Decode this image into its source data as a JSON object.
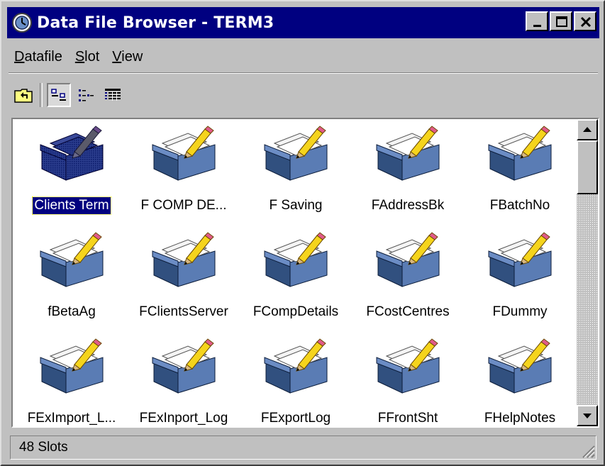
{
  "window": {
    "title": "Data File Browser - TERM3",
    "app_icon": "clock-globe-icon",
    "controls": [
      "minimize-icon",
      "maximize-icon",
      "close-icon"
    ]
  },
  "menu": {
    "items": [
      {
        "label": "Datafile",
        "mnemonic": "D"
      },
      {
        "label": "Slot",
        "mnemonic": "S"
      },
      {
        "label": "View",
        "mnemonic": "V"
      }
    ]
  },
  "toolbar": {
    "buttons": [
      {
        "icon": "up-folder-icon",
        "pressed": false
      },
      {
        "icon": "large-icons-view-icon",
        "pressed": true
      },
      {
        "icon": "small-icons-view-icon",
        "pressed": false
      },
      {
        "icon": "details-view-icon",
        "pressed": false
      }
    ]
  },
  "files": {
    "items": [
      {
        "label": "Clients Term",
        "selected": true
      },
      {
        "label": "F COMP DE...",
        "selected": false
      },
      {
        "label": "F Saving",
        "selected": false
      },
      {
        "label": "FAddressBk",
        "selected": false
      },
      {
        "label": "FBatchNo",
        "selected": false
      },
      {
        "label": "fBetaAg",
        "selected": false
      },
      {
        "label": "FClientsServer",
        "selected": false
      },
      {
        "label": "FCompDetails",
        "selected": false
      },
      {
        "label": "FCostCentres",
        "selected": false
      },
      {
        "label": "FDummy",
        "selected": false
      },
      {
        "label": "FExImport_L...",
        "selected": false
      },
      {
        "label": "FExInport_Log",
        "selected": false
      },
      {
        "label": "FExportLog",
        "selected": false
      },
      {
        "label": "FFrontSht",
        "selected": false
      },
      {
        "label": "FHelpNotes",
        "selected": false
      }
    ],
    "item_icon": "folder-pencil-icon"
  },
  "status": {
    "text": "48 Slots"
  },
  "colors": {
    "titlebar": "#000080",
    "face": "#c0c0c0",
    "selection": "#000080",
    "folder_blue": "#4a6a9e"
  }
}
